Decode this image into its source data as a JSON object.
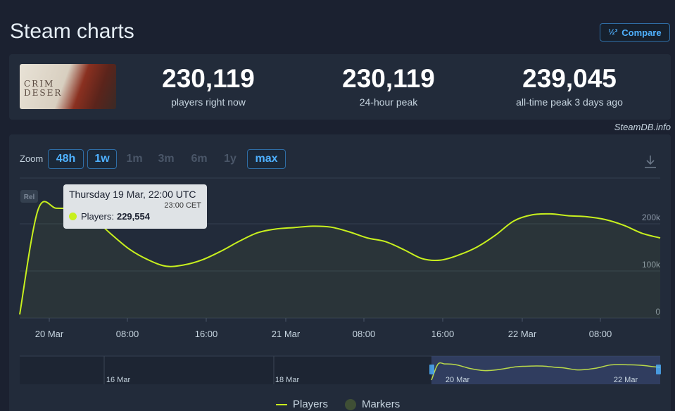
{
  "header": {
    "title": "Steam charts",
    "compare_label": "Compare",
    "compare_icon_text": "1/2 3"
  },
  "game": {
    "cover_text": "CRIM DESER"
  },
  "stats": [
    {
      "value": "230,119",
      "label": "players right now"
    },
    {
      "value": "230,119",
      "label": "24-hour peak"
    },
    {
      "value": "239,045",
      "label": "all-time peak 3 days ago"
    }
  ],
  "watermark": "SteamDB.info",
  "zoom": {
    "label": "Zoom",
    "options": [
      {
        "label": "48h",
        "state": "active"
      },
      {
        "label": "1w",
        "state": "active"
      },
      {
        "label": "1m",
        "state": "disabled"
      },
      {
        "label": "3m",
        "state": "disabled"
      },
      {
        "label": "6m",
        "state": "disabled"
      },
      {
        "label": "1y",
        "state": "disabled"
      },
      {
        "label": "max",
        "state": "active"
      }
    ]
  },
  "rel_badge": "Rel",
  "tooltip": {
    "title": "Thursday 19 Mar, 22:00 UTC",
    "subtitle": "23:00 CET",
    "series_label": "Players:",
    "value": "229,554"
  },
  "legend": {
    "players": "Players",
    "markers": "Markers"
  },
  "colors": {
    "line": "#c8f01e",
    "accent": "#4fb1ff",
    "navigator_window": "#3a4a78"
  },
  "chart_data": {
    "type": "line",
    "series": [
      {
        "name": "Players",
        "x": [
          "19 Mar 17:00",
          "19 Mar 19:00",
          "19 Mar 21:00",
          "19 Mar 22:00",
          "20 Mar 00:00",
          "20 Mar 02:00",
          "20 Mar 04:00",
          "20 Mar 06:00",
          "20 Mar 08:00",
          "20 Mar 10:00",
          "20 Mar 12:00",
          "20 Mar 14:00",
          "20 Mar 16:00",
          "20 Mar 18:00",
          "20 Mar 20:00",
          "20 Mar 22:00",
          "21 Mar 00:00",
          "21 Mar 02:00",
          "21 Mar 04:00",
          "21 Mar 06:00",
          "21 Mar 08:00",
          "21 Mar 10:00",
          "21 Mar 12:00",
          "21 Mar 14:00",
          "21 Mar 16:00",
          "21 Mar 18:00",
          "21 Mar 20:00",
          "21 Mar 22:00",
          "22 Mar 00:00",
          "22 Mar 02:00",
          "22 Mar 04:00",
          "22 Mar 06:00",
          "22 Mar 08:00",
          "22 Mar 10:00",
          "22 Mar 12:00",
          "22 Mar 14:00"
        ],
        "values": [
          8000,
          229554,
          233000,
          229554,
          212000,
          178000,
          146000,
          124000,
          110000,
          113000,
          124000,
          142000,
          163000,
          181000,
          189000,
          192000,
          195000,
          193000,
          183000,
          170000,
          162000,
          145000,
          126000,
          123000,
          134000,
          151000,
          176000,
          206000,
          219000,
          221000,
          217000,
          215000,
          209000,
          197000,
          180000,
          170000
        ]
      }
    ],
    "y_axis": {
      "ticks": [
        "0",
        "100k",
        "200k"
      ],
      "ylim": [
        0,
        250000
      ]
    },
    "x_axis": {
      "ticks": [
        "20 Mar",
        "08:00",
        "16:00",
        "21 Mar",
        "08:00",
        "16:00",
        "22 Mar",
        "08:00"
      ]
    },
    "navigator": {
      "labels": [
        "16 Mar",
        "18 Mar",
        "20 Mar",
        "22 Mar"
      ]
    },
    "grid": true,
    "legend": "bottom-center"
  }
}
